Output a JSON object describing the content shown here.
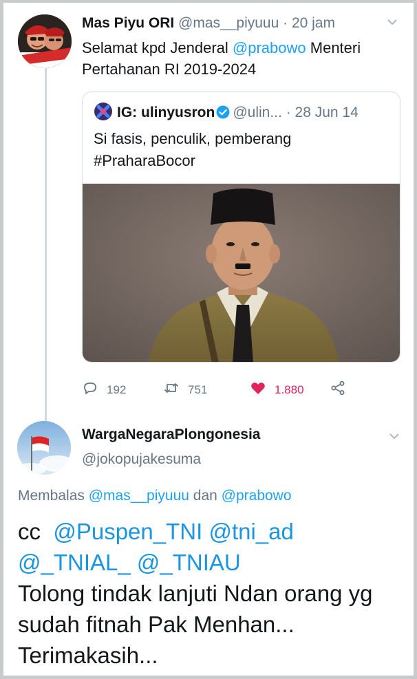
{
  "tweet": {
    "author_name": "Mas Piyu ORI",
    "author_handle": "@mas__piyuuu",
    "separator": " · ",
    "time": "20 jam",
    "text_before": "Selamat kpd Jenderal ",
    "mention": "@prabowo",
    "text_after": " Menteri Pertahanan RI 2019-2024",
    "quote": {
      "author_name": "IG: ulinyusron",
      "author_handle": "@ulin...",
      "separator": " · ",
      "date": "28 Jun 14",
      "line1": "Si fasis, penculik, pemberang",
      "hashtag": "#PraharaBocor"
    },
    "actions": {
      "replies": "192",
      "retweets": "751",
      "likes": "1.880"
    }
  },
  "reply": {
    "author_name": "WargaNegaraPlongonesia",
    "author_handle": "@jokopujakesuma",
    "replying_prefix": "Membalas ",
    "replying_user1": "@mas__piyuuu",
    "replying_and": " dan ",
    "replying_user2": "@prabowo",
    "cc": "cc",
    "mentions_line1": "@Puspen_TNI @tni_ad",
    "mentions_line2": "@_TNIAL_ @_TNIAU",
    "text": "Tolong tindak lanjuti Ndan orang yg sudah fitnah Pak Menhan... Terimakasih..."
  },
  "colors": {
    "link": "#1da1f2",
    "muted": "#657786",
    "like": "#e0245e",
    "border": "#d7dfe4"
  },
  "icons": [
    "reply-icon",
    "retweet-icon",
    "heart-icon",
    "share-icon",
    "chevron-down-icon",
    "verified-badge-icon"
  ]
}
